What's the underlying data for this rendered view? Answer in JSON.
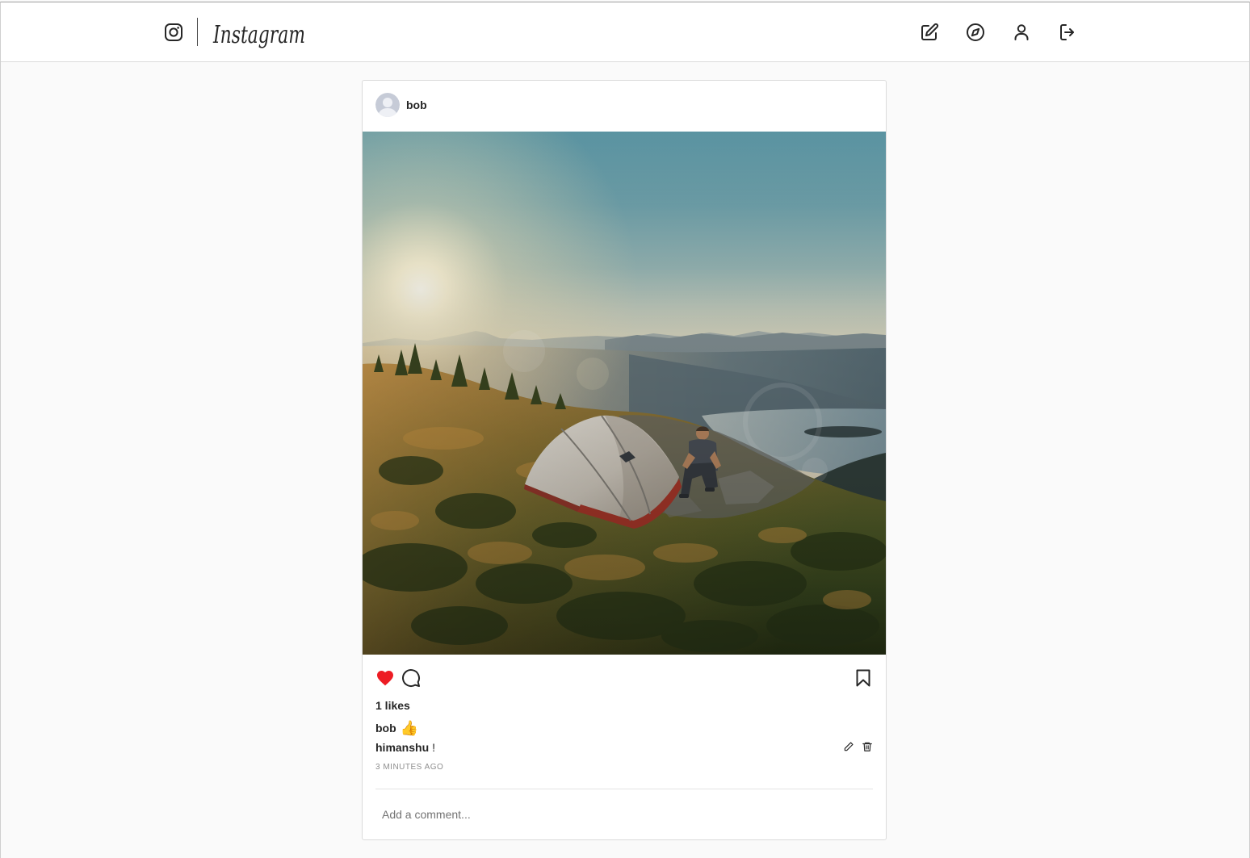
{
  "header": {
    "logo_text": "Instagram",
    "logo_icon": "instagram-camera-icon",
    "nav_icons": [
      "edit-icon",
      "compass-icon",
      "user-icon",
      "logout-icon"
    ]
  },
  "post": {
    "username": "bob",
    "liked": true,
    "likes_text": "1 likes",
    "caption": {
      "username": "bob",
      "text": "👍"
    },
    "comments": [
      {
        "username": "himanshu",
        "text": "!"
      }
    ],
    "time_ago": "3 MINUTES AGO",
    "comment_input": {
      "placeholder": "Add a comment...",
      "value": ""
    },
    "action_icons": [
      "heart-icon",
      "comment-icon",
      "bookmark-icon"
    ],
    "comment_action_icons": [
      "pencil-icon",
      "trash-icon"
    ]
  },
  "colors": {
    "like_red": "#ed1c24",
    "text_primary": "#262626",
    "text_secondary": "#8e8e8e",
    "border": "#dbdbdb",
    "background": "#fafafa"
  }
}
